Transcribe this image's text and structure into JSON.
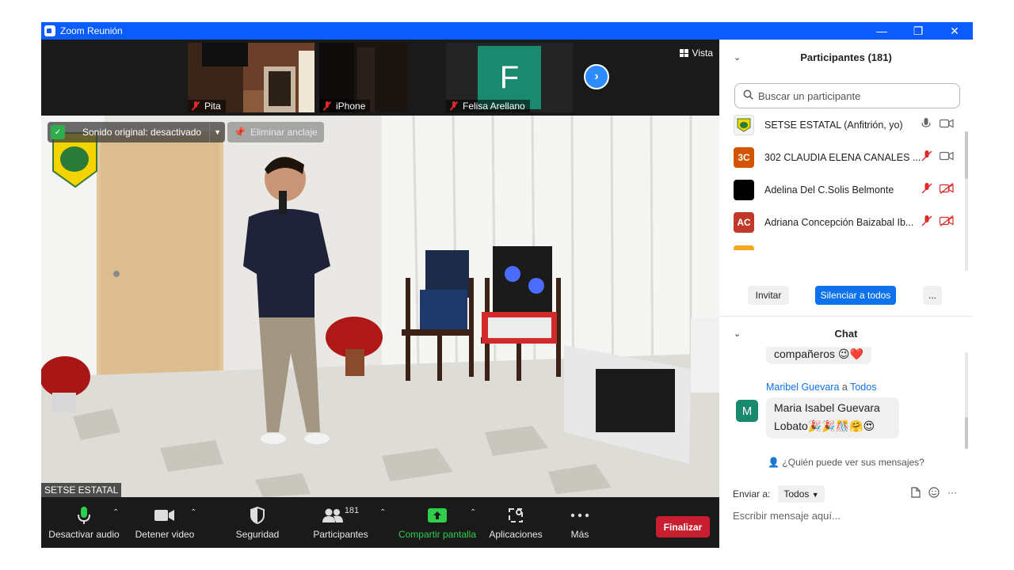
{
  "window": {
    "title": "Zoom Reunión",
    "minimize": "—",
    "restore": "❐",
    "close": "✕"
  },
  "thumbnails": [
    {
      "name": "Pita"
    },
    {
      "name": "iPhone"
    },
    {
      "name": "Felisa Arellano",
      "initial": "F",
      "color": "#1a8a6e"
    }
  ],
  "view": {
    "label": "Vista"
  },
  "main_video": {
    "original_sound": "Sonido original: desactivado",
    "unpin": "Eliminar anclaje",
    "speaker_name": "SETSE ESTATAL"
  },
  "toolbar": {
    "audio": "Desactivar audio",
    "video": "Detener video",
    "security": "Seguridad",
    "participants": "Participantes",
    "participants_count": "181",
    "share": "Compartir pantalla",
    "apps": "Aplicaciones",
    "more": "Más",
    "end": "Finalizar"
  },
  "participants_panel": {
    "title": "Participantes (181)",
    "search_placeholder": "Buscar un participante",
    "list": [
      {
        "name": "SETSE ESTATAL (Anfitrión, yo)",
        "avatar_text": "",
        "avatar_color": "#e8e8e8"
      },
      {
        "name": "302 CLAUDIA ELENA CANALES ...",
        "avatar_text": "3C",
        "avatar_color": "#d35400"
      },
      {
        "name": "Adelina Del C.Solis Belmonte",
        "avatar_text": "",
        "avatar_color": "#000000"
      },
      {
        "name": "Adriana Concepción Baizabal Ib...",
        "avatar_text": "AC",
        "avatar_color": "#c0392b"
      }
    ],
    "invite": "Invitar",
    "mute_all": "Silenciar a todos",
    "more": "..."
  },
  "chat_panel": {
    "title": "Chat",
    "msg1_text": "compañeros 😉❤️",
    "msg2_sender": "Maribel Guevara",
    "msg2_to_word": "a",
    "msg2_recipient": "Todos",
    "msg2_avatar": "M",
    "msg2_line1": "Maria Isabel Guevara",
    "msg2_line2": "Lobato🎉🎉🎊🤗😍",
    "who_can_see": "¿Quién puede ver sus mensajes?",
    "send_to_label": "Enviar a:",
    "send_to_value": "Todos",
    "input_placeholder": "Escribir mensaje aquí..."
  },
  "colors": {
    "accent": "#0b5cff",
    "end_button": "#c81f30",
    "share_green": "#2fce4d",
    "mute_all_button": "#0e72ed",
    "muted_red": "#e02828"
  }
}
